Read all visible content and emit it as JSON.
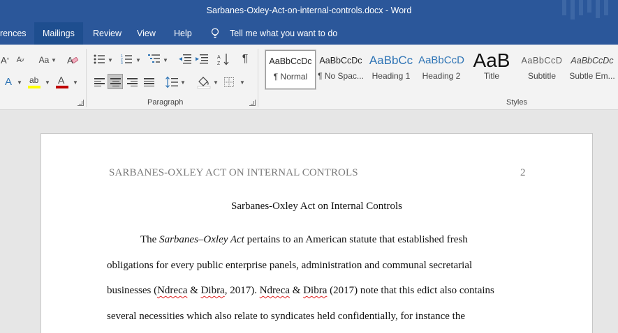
{
  "window": {
    "title": "Sarbanes-Oxley-Act-on-internal-controls.docx  -  Word"
  },
  "tabs": [
    {
      "label": "rences",
      "active": false
    },
    {
      "label": "Mailings",
      "active": true
    },
    {
      "label": "Review",
      "active": false
    },
    {
      "label": "View",
      "active": false
    },
    {
      "label": "Help",
      "active": false
    }
  ],
  "tellme": {
    "text": "Tell me what you want to do"
  },
  "ribbon": {
    "groups": {
      "paragraph": "Paragraph",
      "styles": "Styles"
    },
    "font": {
      "grow": "A",
      "shrink": "A",
      "case": "Aa",
      "highlight_text": "ab",
      "font_color_text": "A",
      "effects_text": "A"
    },
    "styles": [
      {
        "preview": "AaBbCcDc",
        "name": "¶ Normal",
        "selected": true
      },
      {
        "preview": "AaBbCcDc",
        "name": "¶ No Spac...",
        "selected": false
      },
      {
        "preview": "AaBbCc",
        "name": "Heading 1",
        "selected": false
      },
      {
        "preview": "AaBbCcD",
        "name": "Heading 2",
        "selected": false
      },
      {
        "preview": "AaB",
        "name": "Title",
        "selected": false
      },
      {
        "preview": "AaBbCcD",
        "name": "Subtitle",
        "selected": false
      },
      {
        "preview": "AaBbCcDc",
        "name": "Subtle Em...",
        "selected": false
      }
    ]
  },
  "document": {
    "running_head": "SARBANES-OXLEY ACT ON INTERNAL CONTROLS",
    "page_number": "2",
    "title": "Sarbanes-Oxley Act on Internal Controls",
    "lines": {
      "l1_a": "The ",
      "l1_italic": "Sarbanes–Oxley Act",
      "l1_b": " pertains to an American statute that established fresh",
      "l2": "obligations for every public enterprise panels, administration and communal secretarial",
      "l3_a": "businesses (",
      "l3_n1": "Ndreca",
      "l3_amp1": " & ",
      "l3_d1": "Dibra",
      "l3_b": ", 2017). ",
      "l3_n2": "Ndreca",
      "l3_amp2": " & ",
      "l3_d2": "Dibra",
      "l3_c": " (2017) note that this edict also contains",
      "l4": "several necessities which also relate to syndicates held confidentially, for instance the"
    }
  },
  "colors": {
    "ribbon_blue": "#2b579a",
    "active_tab": "#1e4e8f",
    "heading_blue": "#2e74b5",
    "font_red": "#c00000",
    "highlight_yellow": "#ffff00"
  }
}
